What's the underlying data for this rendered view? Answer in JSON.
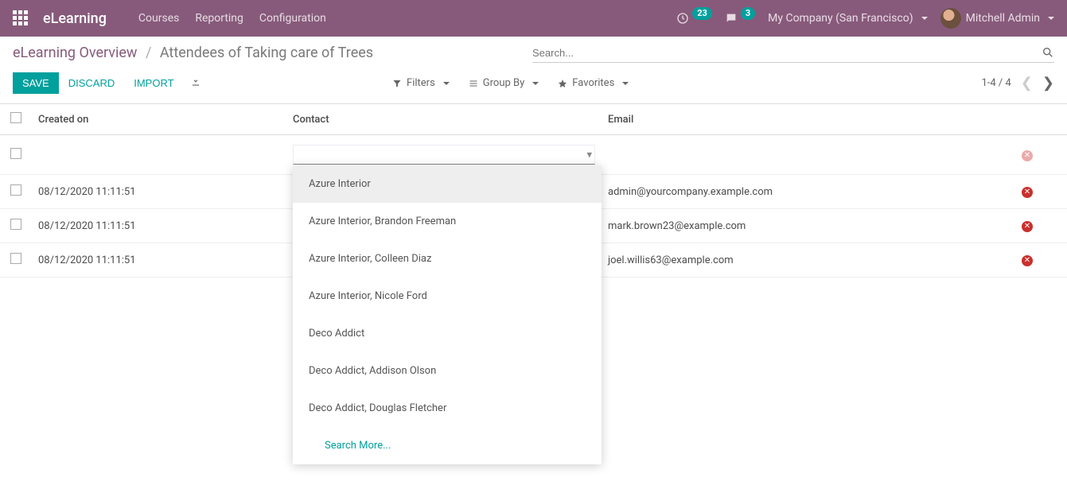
{
  "navbar": {
    "brand": "eLearning",
    "links": [
      "Courses",
      "Reporting",
      "Configuration"
    ],
    "clock_badge": "23",
    "chat_badge": "3",
    "company": "My Company (San Francisco)",
    "user": "Mitchell Admin"
  },
  "breadcrumb": {
    "root": "eLearning Overview",
    "current": "Attendees of Taking care of Trees"
  },
  "search": {
    "placeholder": "Search..."
  },
  "buttons": {
    "save": "Save",
    "discard": "Discard",
    "import": "Import"
  },
  "search_options": {
    "filters": "Filters",
    "group_by": "Group By",
    "favorites": "Favorites"
  },
  "pager": {
    "range": "1-4 / 4"
  },
  "columns": {
    "created": "Created on",
    "contact": "Contact",
    "email": "Email"
  },
  "rows": [
    {
      "created": "",
      "contact": "",
      "email": "",
      "editing": true
    },
    {
      "created": "08/12/2020 11:11:51",
      "contact": "",
      "email": "admin@yourcompany.example.com"
    },
    {
      "created": "08/12/2020 11:11:51",
      "contact": "",
      "email": "mark.brown23@example.com"
    },
    {
      "created": "08/12/2020 11:11:51",
      "contact": "",
      "email": "joel.willis63@example.com"
    }
  ],
  "dropdown": {
    "options": [
      "Azure Interior",
      "Azure Interior, Brandon Freeman",
      "Azure Interior, Colleen Diaz",
      "Azure Interior, Nicole Ford",
      "Deco Addict",
      "Deco Addict, Addison Olson",
      "Deco Addict, Douglas Fletcher"
    ],
    "search_more": "Search More..."
  }
}
